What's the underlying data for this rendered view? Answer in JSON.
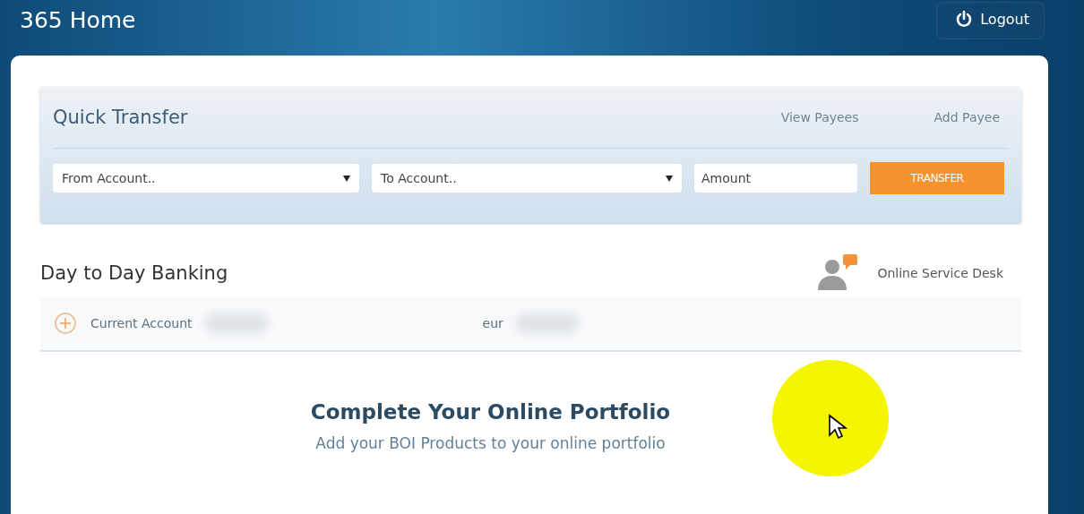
{
  "header": {
    "title": "365 Home",
    "logout": "Logout"
  },
  "quick_transfer": {
    "title": "Quick Transfer",
    "links": [
      "View Payees",
      "Add Payee"
    ],
    "from": {
      "placeholder": "From Account.."
    },
    "to": {
      "placeholder": "To Account.."
    },
    "amount": {
      "placeholder": "Amount"
    },
    "button": "TRANSFER"
  },
  "banking": {
    "title": "Day to Day Banking",
    "service_desk": "Online Service Desk",
    "accounts": [
      {
        "name": "Current Account",
        "currency": "eur",
        "expanded": false
      }
    ]
  },
  "portfolio": {
    "title": "Complete Your Online Portfolio",
    "subtitle": "Add your BOI Products to your online portfolio"
  }
}
